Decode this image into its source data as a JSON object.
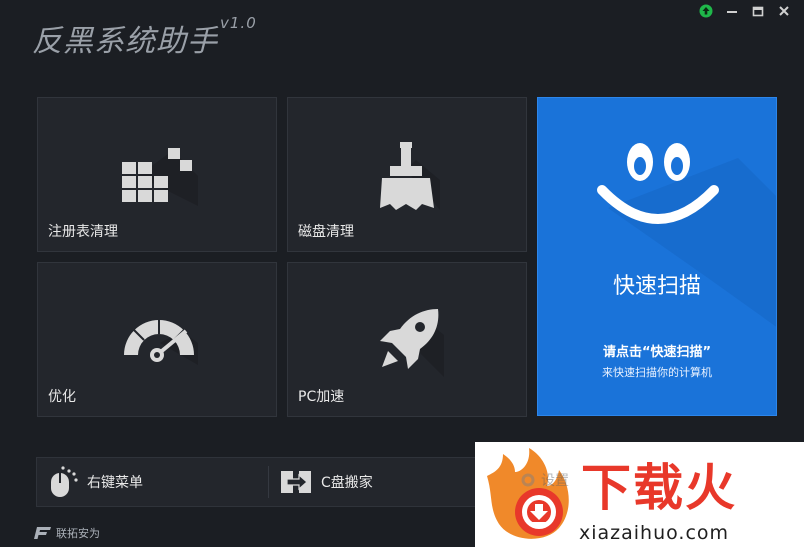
{
  "app": {
    "title": "反黑系统助手",
    "version": "v1.0"
  },
  "window_controls": [
    "upgrade-icon",
    "minimize-icon",
    "maximize-icon",
    "close-icon"
  ],
  "tiles": {
    "registry": {
      "label": "注册表清理",
      "icon": "registry-grid-icon"
    },
    "disk": {
      "label": "磁盘清理",
      "icon": "broom-icon"
    },
    "optimize": {
      "label": "优化",
      "icon": "gauge-icon"
    },
    "pc_speed": {
      "label": "PC加速",
      "icon": "rocket-icon"
    }
  },
  "scan": {
    "title": "快速扫描",
    "hint": "请点击“快速扫描”",
    "sub": "来快速扫描你的计算机",
    "icon": "smiley-icon",
    "color": "#1a73d9"
  },
  "bottom": {
    "context_menu": {
      "label": "右键菜单",
      "icon": "mouse-icon"
    },
    "c_drive_move": {
      "label": "C盘搬家",
      "icon": "move-drive-icon"
    },
    "settings": {
      "label": "设置",
      "icon": "gear-icon"
    }
  },
  "brand": {
    "name": "联拓安为"
  },
  "watermark": {
    "text": "下载火",
    "url": "xiazaihuo.com",
    "color": "#e8382a"
  }
}
